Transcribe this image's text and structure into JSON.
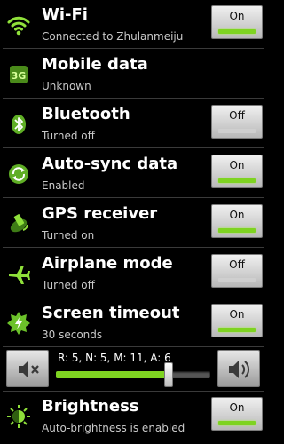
{
  "rows": [
    {
      "title": "Wi-Fi",
      "subtitle": "Connected to Zhulanmeiju",
      "toggle": "On",
      "state": "on",
      "icon": "wifi-icon"
    },
    {
      "title": "Mobile data",
      "subtitle": "Unknown",
      "toggle": "",
      "state": "none",
      "icon": "mobile-data-3g-icon",
      "icon_text": "3G"
    },
    {
      "title": "Bluetooth",
      "subtitle": "Turned off",
      "toggle": "Off",
      "state": "off",
      "icon": "bluetooth-icon"
    },
    {
      "title": "Auto-sync data",
      "subtitle": "Enabled",
      "toggle": "On",
      "state": "on",
      "icon": "sync-icon"
    },
    {
      "title": "GPS receiver",
      "subtitle": "Turned on",
      "toggle": "On",
      "state": "on",
      "icon": "gps-icon"
    },
    {
      "title": "Airplane mode",
      "subtitle": "Turned off",
      "toggle": "Off",
      "state": "off",
      "icon": "airplane-icon"
    },
    {
      "title": "Screen timeout",
      "subtitle": "30 seconds",
      "toggle": "On",
      "state": "on",
      "icon": "screen-timeout-icon"
    },
    {
      "title": "Brightness",
      "subtitle": "Auto-brightness is enabled",
      "toggle": "On",
      "state": "on",
      "icon": "brightness-icon"
    }
  ],
  "volume": {
    "text": "R: 5, N: 5, M: 11, A: 6",
    "level": 0.73,
    "mute_icon": "volume-mute-icon",
    "loud_icon": "volume-up-icon"
  },
  "colors": {
    "accent": "#7ed321",
    "background": "#000000",
    "subtitle": "#c9c9c9"
  }
}
